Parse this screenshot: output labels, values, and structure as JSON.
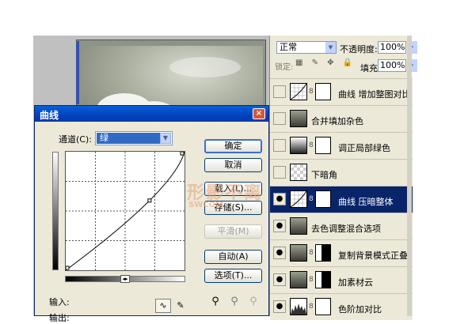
{
  "curves_dialog": {
    "title": "曲线",
    "close_glyph": "×",
    "channel_label": "通道(C):",
    "channel_value": "绿",
    "input_label": "输入:",
    "output_label": "输出:",
    "buttons": {
      "ok": "确定",
      "cancel": "取消",
      "load": "载入(L)...",
      "save": "存储(S)...",
      "smooth": "平滑(M)",
      "auto": "自动(A)",
      "options": "选项(T)..."
    },
    "curve_tool_glyph": "∿",
    "pencil_tool_glyph": "✎",
    "curve": {
      "points": [
        [
          0,
          0
        ],
        [
          180,
          150
        ],
        [
          255,
          255
        ]
      ]
    }
  },
  "watermark": {
    "text": "形影不离",
    "sub": "SWCOM"
  },
  "layers_panel": {
    "blend_mode": "正常",
    "opacity_label": "不透明度:",
    "opacity_value": "100%",
    "lock_label": "锁定:",
    "fill_label": "填充:",
    "fill_value": "100%",
    "layers": [
      {
        "name": "曲线 增加整图对比",
        "visible": false,
        "selected": false,
        "type": "curves-adjustment",
        "has_mask": true
      },
      {
        "name": "合并填加杂色",
        "visible": false,
        "selected": false,
        "type": "photo",
        "has_mask": false
      },
      {
        "name": "调正局部绿色",
        "visible": false,
        "selected": false,
        "type": "gradient-adjustment",
        "has_mask": true
      },
      {
        "name": "下暗角",
        "visible": false,
        "selected": false,
        "type": "transparent",
        "has_mask": false
      },
      {
        "name": "曲线 压暗整体",
        "visible": true,
        "selected": true,
        "type": "curves-adjustment",
        "has_mask": true
      },
      {
        "name": "去色调整混合选项",
        "visible": true,
        "selected": false,
        "type": "photo",
        "has_mask": false
      },
      {
        "name": "复制背景模式正叠",
        "visible": true,
        "selected": false,
        "type": "photo-mask",
        "has_mask": true
      },
      {
        "name": "加素材云",
        "visible": true,
        "selected": false,
        "type": "photo-mask",
        "has_mask": true
      },
      {
        "name": "色阶加对比",
        "visible": true,
        "selected": false,
        "type": "levels-adjustment",
        "has_mask": true
      }
    ]
  },
  "colors": {
    "titlebar": "#0042c0",
    "selection": "#0a246a",
    "dialog_bg": "#ece9d8"
  }
}
